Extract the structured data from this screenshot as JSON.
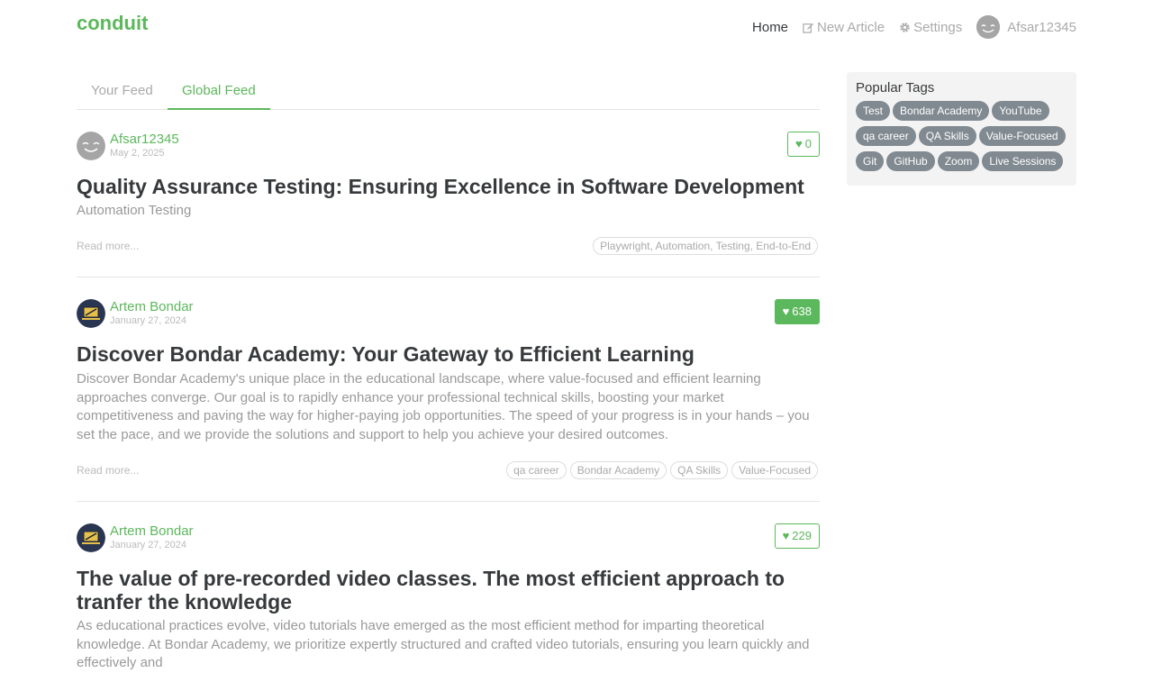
{
  "brand": "conduit",
  "nav": {
    "home": "Home",
    "new_article": "New Article",
    "settings": "Settings",
    "user": "Afsar12345"
  },
  "feed_tabs": [
    "Your Feed",
    "Global Feed"
  ],
  "articles": [
    {
      "author": "Afsar12345",
      "date": "May 2, 2025",
      "likes": "0",
      "title": "Quality Assurance Testing: Ensuring Excellence in Software Development",
      "description": "Automation Testing",
      "read_more": "Read more...",
      "tags": [
        "Playwright, Automation, Testing, End-to-End"
      ]
    },
    {
      "author": "Artem Bondar",
      "date": "January 27, 2024",
      "likes": "638",
      "title": "Discover Bondar Academy: Your Gateway to Efficient Learning",
      "description": "Discover Bondar Academy's unique place in the educational landscape, where value-focused and efficient learning approaches converge. Our goal is to rapidly enhance your professional technical skills, boosting your market competitiveness and paving the way for higher-paying job opportunities. The speed of your progress is in your hands – you set the pace, and we provide the solutions and support to help you achieve your desired outcomes.",
      "read_more": "Read more...",
      "tags": [
        "qa career",
        "Bondar Academy",
        "QA Skills",
        "Value-Focused"
      ]
    },
    {
      "author": "Artem Bondar",
      "date": "January 27, 2024",
      "likes": "229",
      "title": "The value of pre-recorded video classes. The most efficient approach to tranfer the knowledge",
      "description": "As educational practices evolve, video tutorials have emerged as the most efficient method for imparting theoretical knowledge. At Bondar Academy, we prioritize expertly structured and crafted video tutorials, ensuring you learn quickly and effectively and"
    }
  ],
  "sidebar": {
    "title": "Popular Tags",
    "tags": [
      "Test",
      "Bondar Academy",
      "YouTube",
      "qa career",
      "QA Skills",
      "Value-Focused",
      "Git",
      "GitHub",
      "Zoom",
      "Live Sessions"
    ]
  },
  "colors": {
    "accent": "#5cb85c",
    "tag_bg": "#818a91"
  }
}
